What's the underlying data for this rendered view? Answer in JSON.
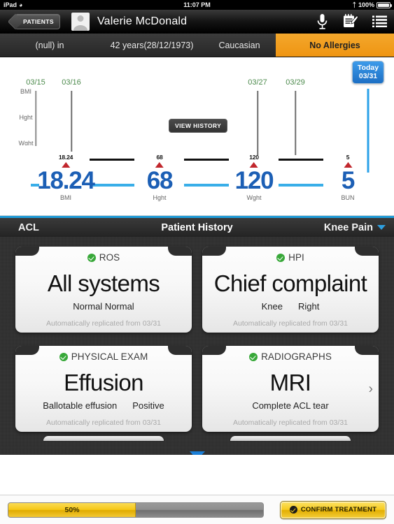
{
  "status_bar": {
    "device": "iPad",
    "wifi_icon": "wifi-icon",
    "time": "11:07 PM",
    "bluetooth_icon": "bluetooth-icon",
    "battery_percent": "100%"
  },
  "nav_bar": {
    "back_label": "PATIENTS",
    "avatar_icon": "patient-avatar",
    "patient_name": "Valerie McDonald",
    "icons": [
      "microphone-icon",
      "note-edit-icon",
      "list-icon"
    ]
  },
  "demographics": {
    "bmi": "(null) in",
    "age": "42 years(28/12/1973)",
    "race": "Caucasian",
    "allergy": "No Allergies",
    "allergy_color": "#f0a01e"
  },
  "chart_data": {
    "type": "timeline",
    "view_history_label": "VIEW HISTORY",
    "today_label": "Today",
    "today_date": "03/31",
    "event_dates": [
      "03/15",
      "03/16",
      "03/27",
      "03/29"
    ],
    "axis_labels": [
      "BMI",
      "Hght",
      "Wght"
    ],
    "metrics": [
      {
        "name": "BMI",
        "value": "18.24",
        "mini": "18.24"
      },
      {
        "name": "Hght",
        "value": "68",
        "mini": "68"
      },
      {
        "name": "Wght",
        "value": "120",
        "mini": "120"
      },
      {
        "name": "BUN",
        "value": "5",
        "mini": "5"
      }
    ],
    "date_color": "#4c8a4c",
    "value_color": "#1c5fb5",
    "marker_color": "#c1272d"
  },
  "history_header": {
    "left_label": "ACL",
    "title": "Patient History",
    "right_label": "Knee Pain",
    "dropdown_icon": "chevron-down-icon",
    "accent_color": "#1f9bd8"
  },
  "cards": [
    {
      "header": "ROS",
      "main": "All systems",
      "sub": [
        "Normal Normal"
      ],
      "footer": "Automatically replicated from 03/31",
      "has_chevron": false
    },
    {
      "header": "HPI",
      "main": "Chief complaint",
      "sub": [
        "Knee",
        "Right"
      ],
      "footer": "Automatically replicated from 03/31",
      "has_chevron": false
    },
    {
      "header": "PHYSICAL EXAM",
      "main": "Effusion",
      "sub": [
        "Ballotable effusion",
        "Positive"
      ],
      "footer": "Automatically replicated from 03/31",
      "has_chevron": false
    },
    {
      "header": "RADIOGRAPHS",
      "main": "MRI",
      "sub": [
        "Complete ACL tear"
      ],
      "footer": "Automatically replicated from 03/31",
      "has_chevron": true,
      "chevron_icon": "chevron-right-icon"
    }
  ],
  "scroll_indicator_icon": "scroll-down-triangle-icon",
  "toolbar": {
    "progress_percent": "50%",
    "progress_value": 50,
    "confirm_label": "CONFIRM TREATMENT",
    "confirm_icon": "check-circle-icon",
    "progress_color": "#f5c716",
    "confirm_color": "#f6cb1e"
  }
}
